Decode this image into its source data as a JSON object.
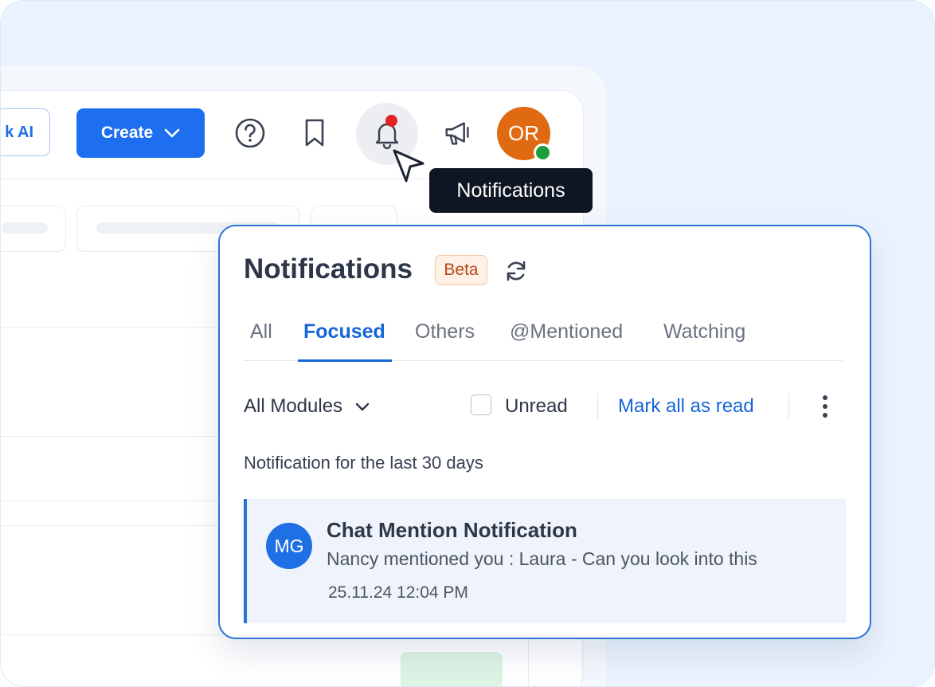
{
  "header": {
    "ask_ai_label": "k AI",
    "create_label": "Create",
    "tooltip": "Notifications",
    "avatar_initials": "OR"
  },
  "panel": {
    "title": "Notifications",
    "beta_badge": "Beta",
    "tabs": [
      {
        "label": "All",
        "active": false
      },
      {
        "label": "Focused",
        "active": true
      },
      {
        "label": "Others",
        "active": false
      },
      {
        "label": "@Mentioned",
        "active": false
      },
      {
        "label": "Watching",
        "active": false
      }
    ],
    "modules_select": "All Modules",
    "unread_label": "Unread",
    "unread_checked": false,
    "mark_all_label": "Mark all as read",
    "subtitle": "Notification for the last 30 days",
    "notifications": [
      {
        "avatar_initials": "MG",
        "title": "Chat Mention Notification",
        "message": "Nancy mentioned you : Laura - Can you look into this",
        "time": "25.11.24 12:04 PM"
      }
    ]
  },
  "colors": {
    "accent": "#1d6ff0",
    "notification_dot": "#e02424",
    "online_status": "#1e9e3a",
    "avatar_or": "#e06a12",
    "avatar_mg": "#1f6fe5",
    "beta_text": "#b8471b"
  }
}
